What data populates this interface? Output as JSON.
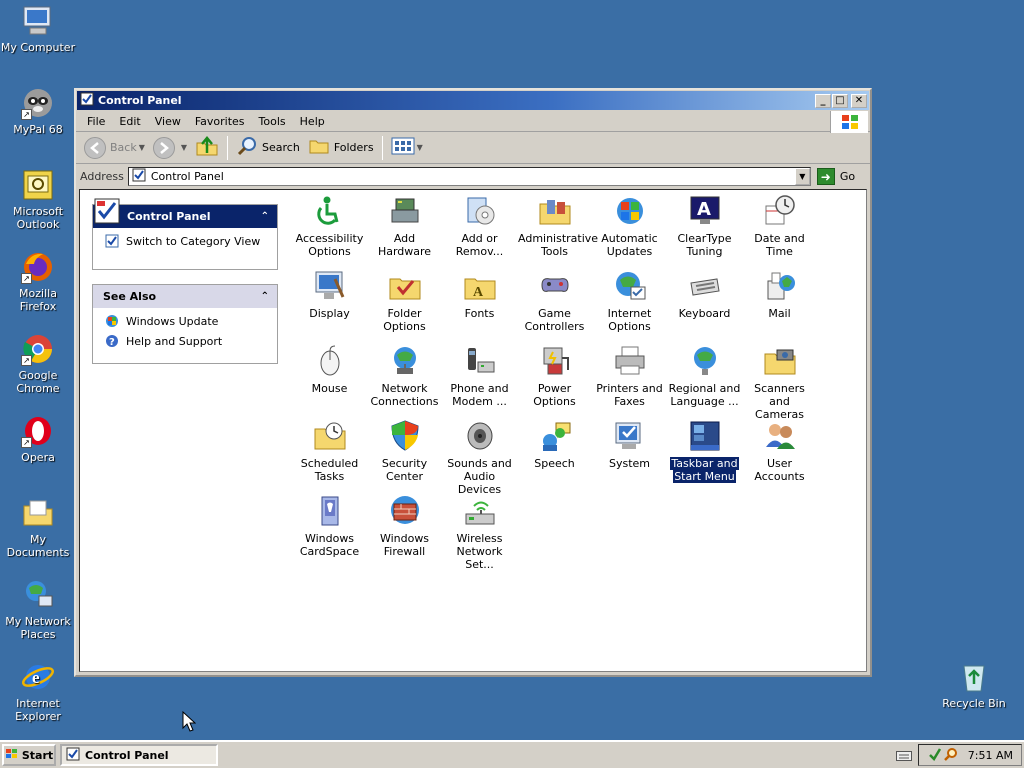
{
  "desktop": {
    "icons": [
      {
        "label": "My Computer"
      },
      {
        "label": "MyPal 68"
      },
      {
        "label": "Microsoft Outlook"
      },
      {
        "label": "Mozilla Firefox"
      },
      {
        "label": "Google Chrome"
      },
      {
        "label": "Opera"
      },
      {
        "label": "My Documents"
      },
      {
        "label": "My Network Places"
      },
      {
        "label": "Internet Explorer"
      },
      {
        "label": "Recycle Bin"
      }
    ]
  },
  "window": {
    "title": "Control Panel",
    "menu": [
      "File",
      "Edit",
      "View",
      "Favorites",
      "Tools",
      "Help"
    ],
    "toolbar": {
      "back": "Back",
      "search": "Search",
      "folders": "Folders"
    },
    "address": {
      "label": "Address",
      "value": "Control Panel",
      "go": "Go"
    }
  },
  "taskpane": {
    "control_panel": {
      "title": "Control Panel",
      "links": [
        "Switch to Category View"
      ]
    },
    "see_also": {
      "title": "See Also",
      "links": [
        "Windows Update",
        "Help and Support"
      ]
    }
  },
  "items": [
    {
      "l1": "Accessibility",
      "l2": "Options",
      "icon": "accessibility-icon"
    },
    {
      "l1": "Add Hardware",
      "l2": "",
      "icon": "hardware-icon"
    },
    {
      "l1": "Add or",
      "l2": "Remov...",
      "icon": "add-remove-icon"
    },
    {
      "l1": "Administrative",
      "l2": "Tools",
      "icon": "admin-tools-icon"
    },
    {
      "l1": "Automatic",
      "l2": "Updates",
      "icon": "updates-icon"
    },
    {
      "l1": "ClearType",
      "l2": "Tuning",
      "icon": "cleartype-icon"
    },
    {
      "l1": "Date and Time",
      "l2": "",
      "icon": "clock-icon"
    },
    {
      "l1": "Display",
      "l2": "",
      "icon": "display-icon"
    },
    {
      "l1": "Folder Options",
      "l2": "",
      "icon": "folder-options-icon"
    },
    {
      "l1": "Fonts",
      "l2": "",
      "icon": "fonts-icon"
    },
    {
      "l1": "Game",
      "l2": "Controllers",
      "icon": "gamepad-icon"
    },
    {
      "l1": "Internet",
      "l2": "Options",
      "icon": "globe-icon"
    },
    {
      "l1": "Keyboard",
      "l2": "",
      "icon": "keyboard-icon"
    },
    {
      "l1": "Mail",
      "l2": "",
      "icon": "mail-icon"
    },
    {
      "l1": "Mouse",
      "l2": "",
      "icon": "mouse-icon"
    },
    {
      "l1": "Network",
      "l2": "Connections",
      "icon": "network-icon"
    },
    {
      "l1": "Phone and",
      "l2": "Modem ...",
      "icon": "phone-icon"
    },
    {
      "l1": "Power Options",
      "l2": "",
      "icon": "power-icon"
    },
    {
      "l1": "Printers and",
      "l2": "Faxes",
      "icon": "printer-icon"
    },
    {
      "l1": "Regional and",
      "l2": "Language ...",
      "icon": "regional-icon"
    },
    {
      "l1": "Scanners and",
      "l2": "Cameras",
      "icon": "scanner-icon"
    },
    {
      "l1": "Scheduled",
      "l2": "Tasks",
      "icon": "scheduled-tasks-icon"
    },
    {
      "l1": "Security",
      "l2": "Center",
      "icon": "shield-icon"
    },
    {
      "l1": "Sounds and",
      "l2": "Audio Devices",
      "icon": "speaker-icon"
    },
    {
      "l1": "Speech",
      "l2": "",
      "icon": "speech-icon"
    },
    {
      "l1": "System",
      "l2": "",
      "icon": "system-icon"
    },
    {
      "l1": "Taskbar and",
      "l2": "Start Menu",
      "icon": "taskbar-icon",
      "selected": true
    },
    {
      "l1": "User Accounts",
      "l2": "",
      "icon": "users-icon"
    },
    {
      "l1": "Windows",
      "l2": "CardSpace",
      "icon": "cardspace-icon"
    },
    {
      "l1": "Windows",
      "l2": "Firewall",
      "icon": "firewall-icon"
    },
    {
      "l1": "Wireless",
      "l2": "Network Set...",
      "icon": "wireless-icon"
    }
  ],
  "taskbar": {
    "start": "Start",
    "task": "Control Panel",
    "clock": "7:51 AM"
  },
  "colors": {
    "desktop": "#3a6ea5",
    "title_active": "#0a246a",
    "selection": "#0a246a"
  }
}
